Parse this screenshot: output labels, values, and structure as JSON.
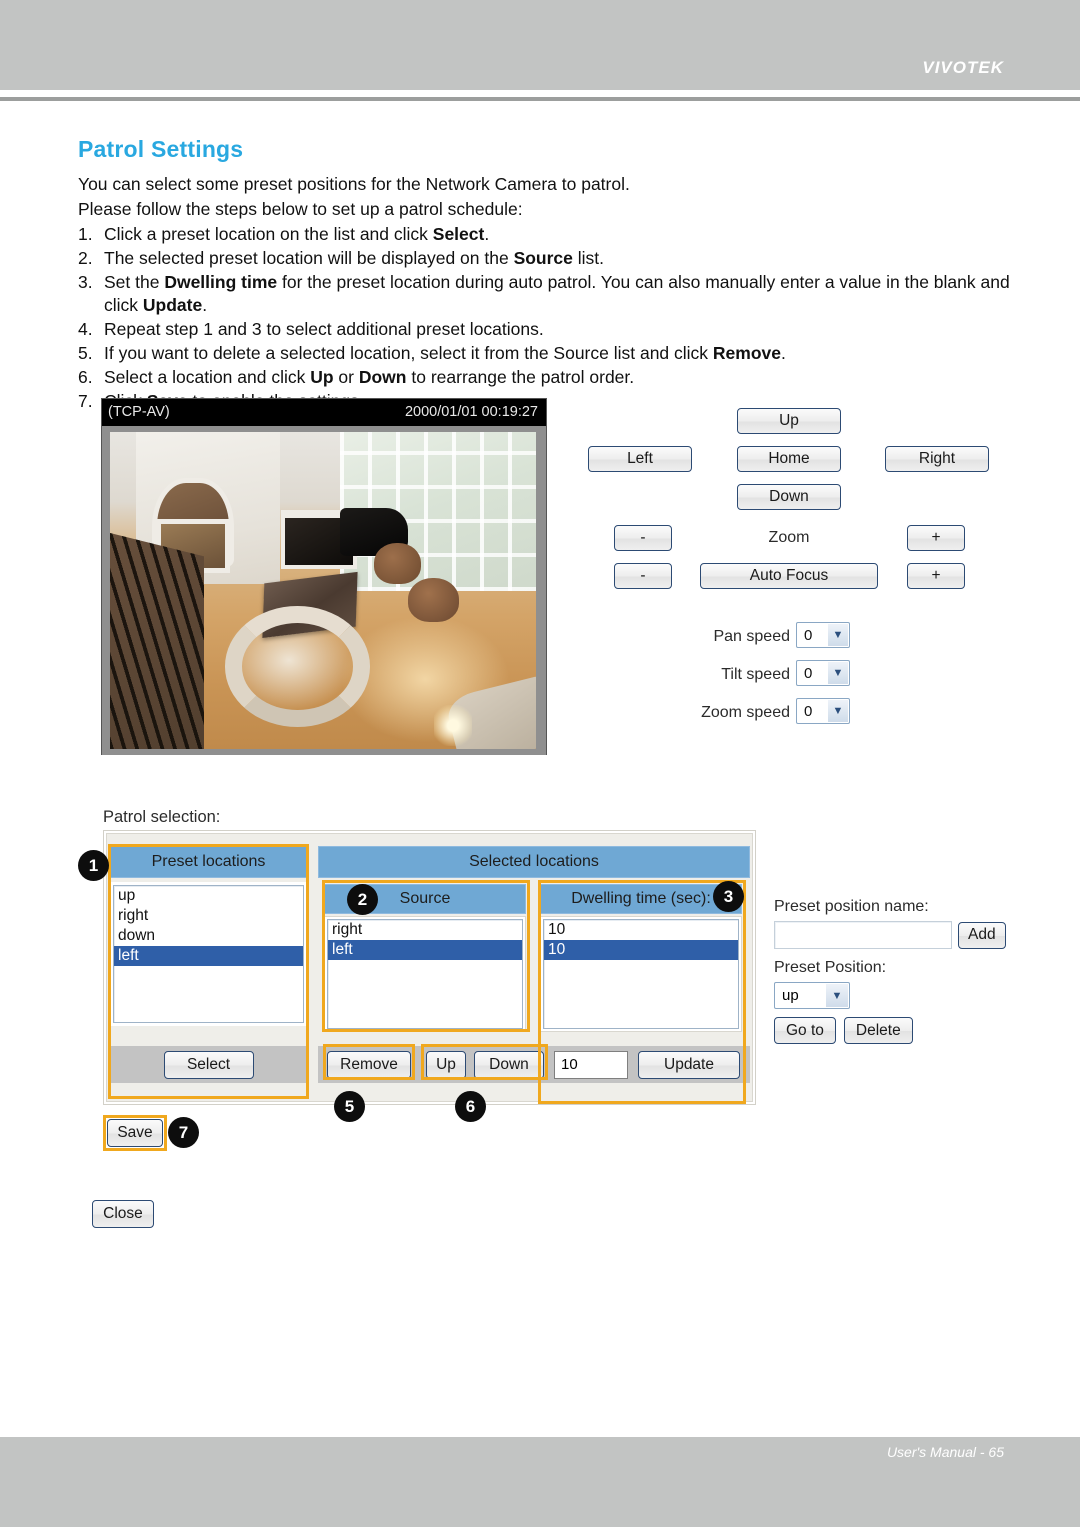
{
  "header": {
    "brand": "VIVOTEK"
  },
  "footer": {
    "text": "User's Manual - 65"
  },
  "doc": {
    "title": "Patrol Settings",
    "intro1": "You can select some preset positions for the Network Camera to patrol.",
    "intro2": "Please follow the steps below to set up a patrol schedule:",
    "steps": [
      {
        "num": "1.",
        "text": "Click a preset location on the list and click Select."
      },
      {
        "num": "2.",
        "text": "The selected preset location will be displayed on the Source list."
      },
      {
        "num": "3.",
        "text": "Set the Dwelling time for the preset location during auto patrol. You can also manually enter a value in the blank and click Update."
      },
      {
        "num": "4.",
        "text": "Repeat step 1 and 3 to select additional preset locations."
      },
      {
        "num": "5.",
        "text": "If you want to delete a selected location, select it from the Source list and click Remove."
      },
      {
        "num": "6.",
        "text": "Select a location and click Up or Down to rearrange the patrol order."
      },
      {
        "num": "7.",
        "text": "Click Save to enable the settings."
      }
    ]
  },
  "video": {
    "protocol": "(TCP-AV)",
    "timestamp": "2000/01/01 00:19:27"
  },
  "ptz": {
    "up": "Up",
    "left": "Left",
    "home": "Home",
    "right": "Right",
    "down": "Down",
    "zoom_label": "Zoom",
    "zoom_minus": "-",
    "zoom_plus": "+",
    "focus_minus": "-",
    "focus_plus": "+",
    "auto_focus": "Auto Focus"
  },
  "speeds": [
    {
      "label": "Pan speed",
      "value": "0"
    },
    {
      "label": "Tilt speed",
      "value": "0"
    },
    {
      "label": "Zoom speed",
      "value": "0"
    }
  ],
  "patrol": {
    "section_label": "Patrol selection:",
    "preset_locations": {
      "header": "Preset locations",
      "items": [
        "up",
        "right",
        "down",
        "left"
      ],
      "selected_index": 3,
      "select_button": "Select"
    },
    "selected_locations": {
      "header": "Selected locations",
      "source": {
        "header": "Source",
        "items": [
          "right",
          "left"
        ],
        "selected_index": 1
      },
      "dwelling": {
        "header": "Dwelling time (sec):",
        "items": [
          "10",
          "10"
        ],
        "selected_index": 1,
        "input_value": "10",
        "update_button": "Update"
      },
      "remove_button": "Remove",
      "up_button": "Up",
      "down_button": "Down"
    }
  },
  "preset_panel": {
    "name_label": "Preset position name:",
    "name_value": "",
    "add_button": "Add",
    "position_label": "Preset Position:",
    "position_value": "up",
    "goto_button": "Go to",
    "delete_button": "Delete"
  },
  "actions": {
    "save": "Save",
    "close": "Close"
  },
  "callouts": {
    "c1": "1",
    "c2": "2",
    "c3": "3",
    "c5": "5",
    "c6": "6",
    "c7": "7"
  },
  "colors": {
    "title_blue": "#29a8e0",
    "header_blue": "#6fa8d4",
    "select_blue": "#2f5fa8",
    "highlight_orange": "#f0a81e",
    "chrome_gray": "#c2c4c3"
  }
}
